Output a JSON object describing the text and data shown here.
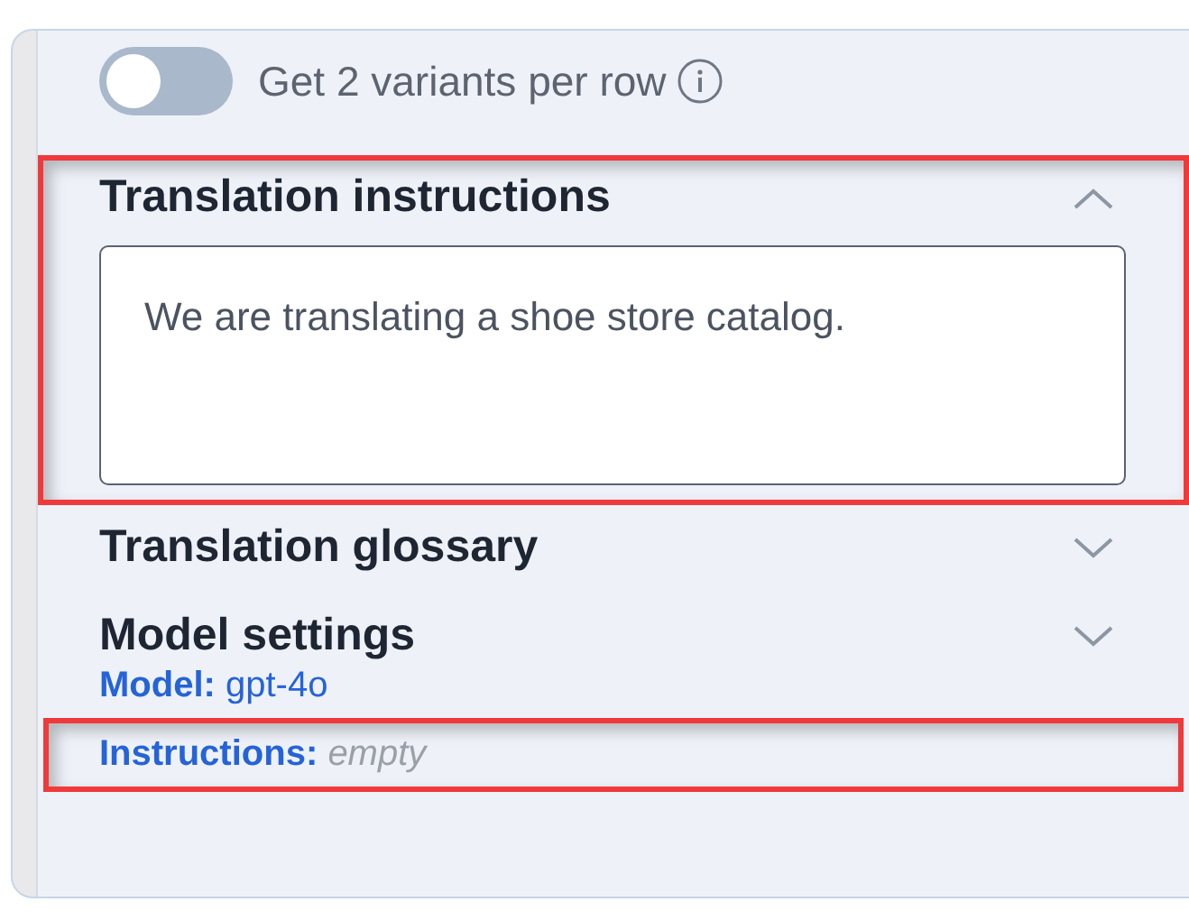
{
  "variants_toggle": {
    "label": "Get 2 variants per row",
    "on": false
  },
  "sections": [
    {
      "kind": "textarea",
      "title": "Translation instructions",
      "expanded": true,
      "highlighted": true,
      "value": "We are translating a shoe store catalog."
    },
    {
      "kind": "plain",
      "title": "Translation glossary",
      "expanded": false,
      "highlighted": false
    },
    {
      "kind": "settings",
      "title": "Model settings",
      "expanded": false,
      "highlighted": false,
      "lines": [
        {
          "label": "Model:",
          "value": "gpt-4o",
          "empty": false,
          "highlighted": false
        },
        {
          "label": "Instructions:",
          "value": "empty",
          "empty": true,
          "highlighted": true
        }
      ]
    }
  ]
}
